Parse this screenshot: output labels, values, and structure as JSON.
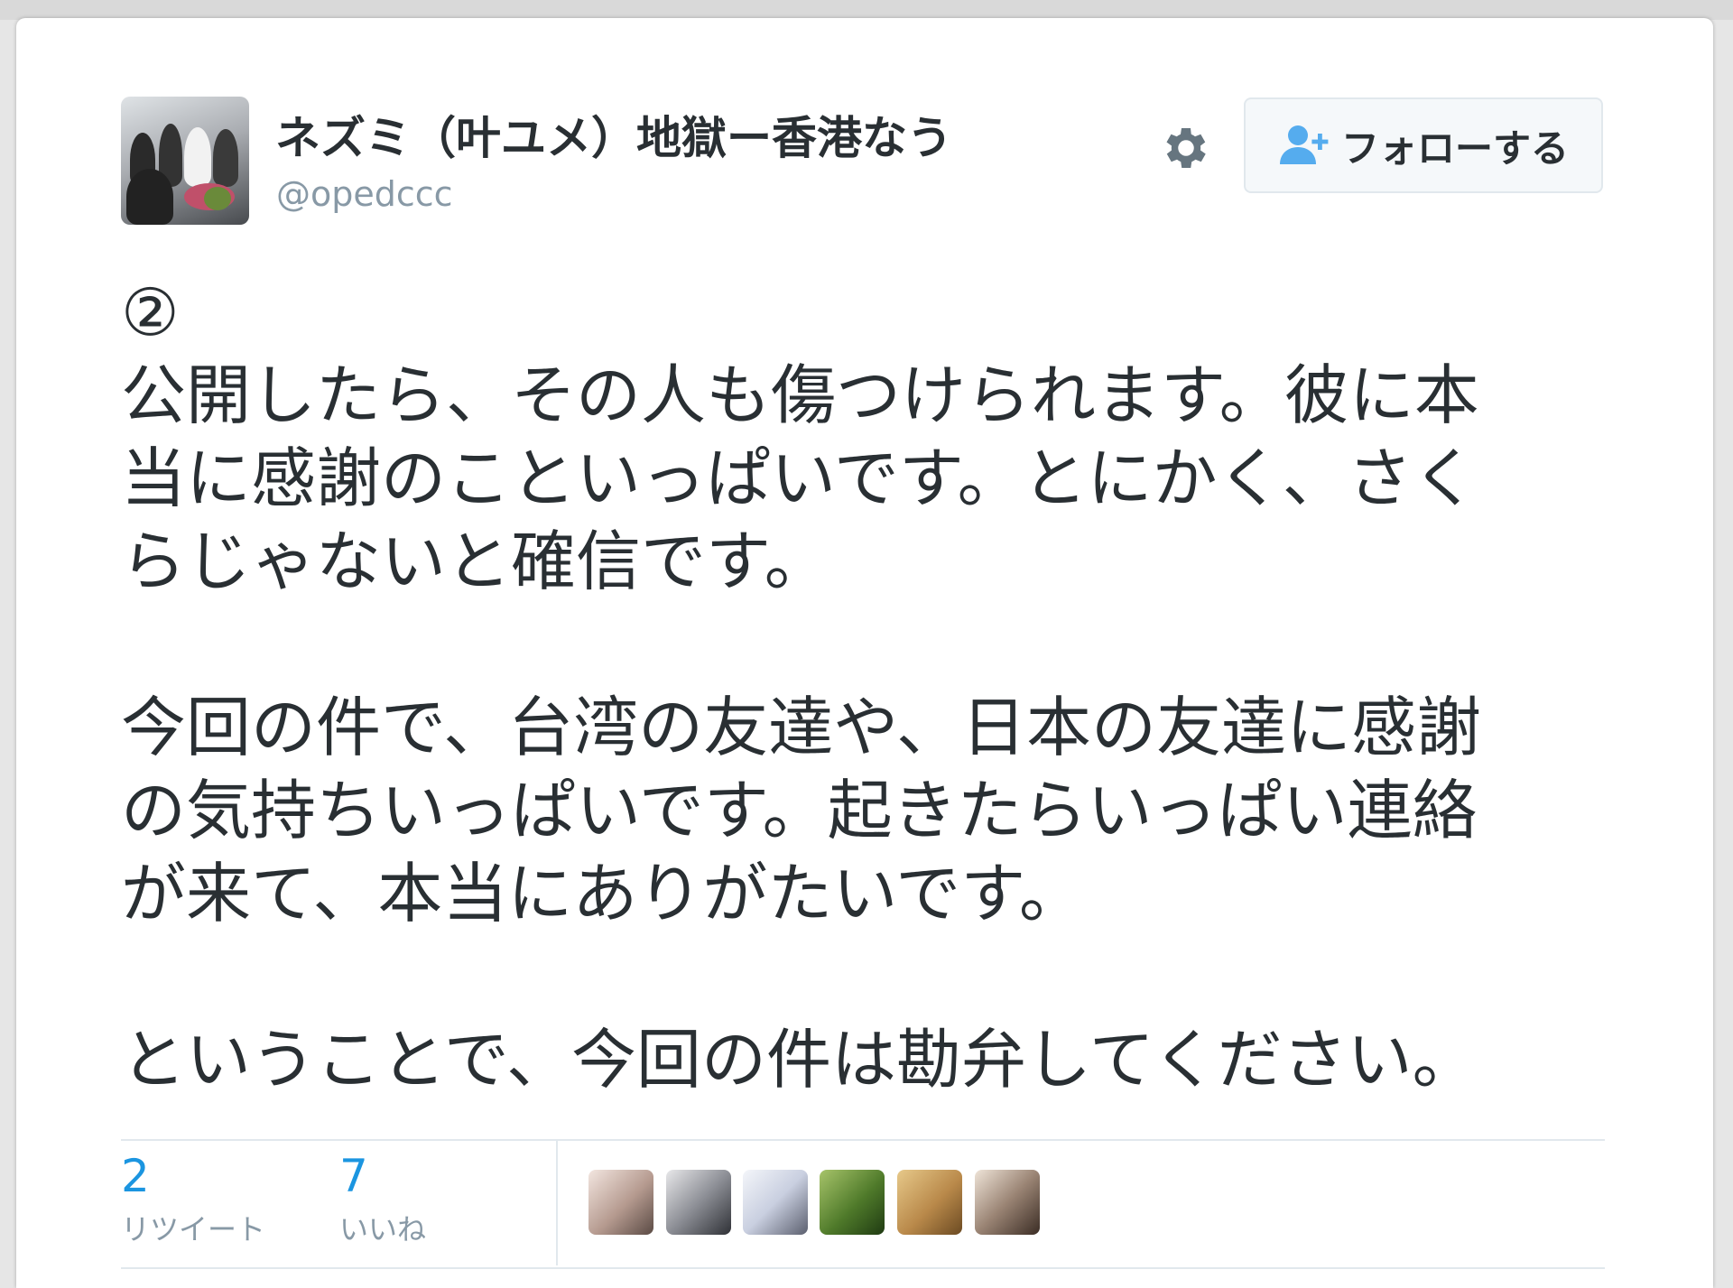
{
  "tweet": {
    "author": {
      "display_name": "ネズミ（叶ユメ）地獄ー香港なう",
      "screen_name": "@opedccc"
    },
    "follow_button": {
      "label": "フォローする",
      "icon": "user-plus-icon"
    },
    "settings_icon": "gear-icon",
    "text_lines": [
      "②",
      "公開したら、その人も傷つけられます。彼に本",
      "当に感謝のこといっぱいです。とにかく、さく",
      "らじゃないと確信です。",
      "",
      "今回の件で、台湾の友達や、日本の友達に感謝",
      "の気持ちいっぱいです。起きたらいっぱい連絡",
      "が来て、本当にありがたいです。",
      "",
      "ということで、今回の件は勘弁してください。"
    ],
    "stats": {
      "retweets": {
        "count": "2",
        "label": "リツイート"
      },
      "likes": {
        "count": "7",
        "label": "いいね"
      }
    }
  },
  "colors": {
    "accent": "#1b95e0",
    "text": "#292f33",
    "muted": "#8899a6"
  }
}
